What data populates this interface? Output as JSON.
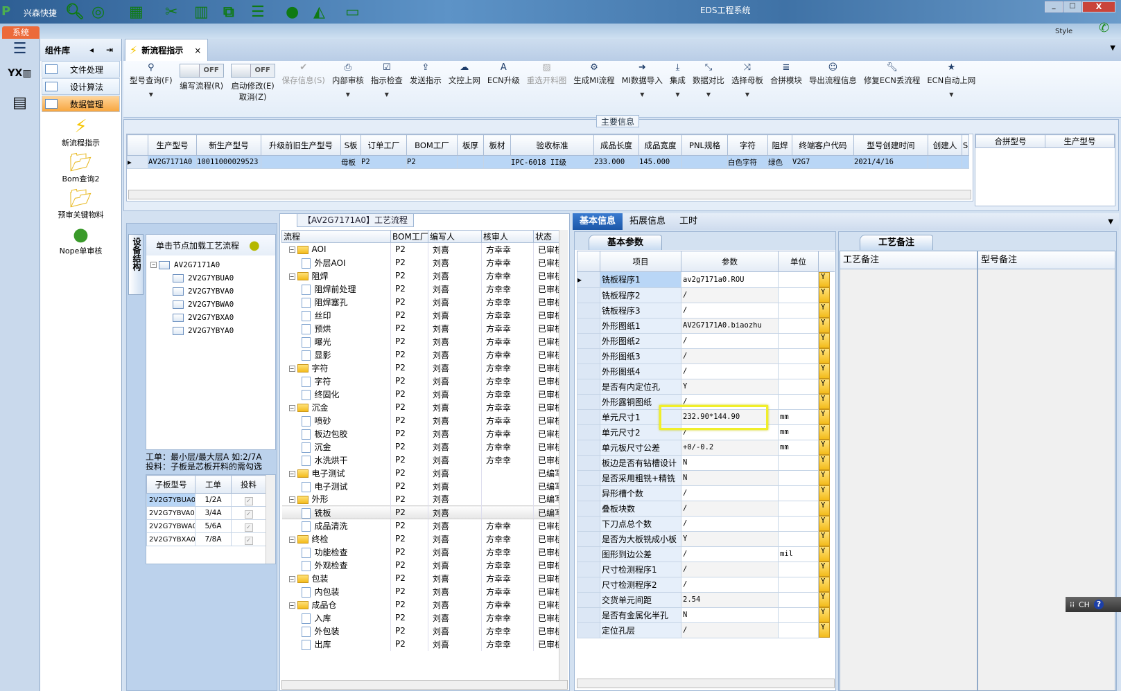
{
  "window": {
    "title": "EDS工程系统",
    "quick_label": "兴森快捷",
    "style_label": "Style",
    "menu_tab": "系统"
  },
  "colors": {
    "accent": "#1c57a8",
    "selected_row": "#b9d6f6",
    "highlight_box": "#f0ee2a",
    "system_tab": "#ec6a3a"
  },
  "component_panel": {
    "title": "组件库",
    "items": [
      {
        "label": "文件处理"
      },
      {
        "label": "设计算法"
      },
      {
        "label": "数据管理",
        "selected": true
      }
    ],
    "shortcuts": [
      {
        "label": "新流程指示",
        "icon": "lightning-icon"
      },
      {
        "label": "Bom查询2",
        "icon": "folder-open-icon"
      },
      {
        "label": "预审关键物料",
        "icon": "folder-open-icon"
      },
      {
        "label": "Nope单审核",
        "icon": "user-icon"
      }
    ]
  },
  "doc_tab": {
    "label": "新流程指示"
  },
  "toolbar": [
    {
      "label": "型号查询(F)",
      "icon": "search-icon",
      "dropdown": true
    },
    {
      "label": "编写流程(R)",
      "toggle": "OFF"
    },
    {
      "label": "启动修改(E)",
      "label2": "取消(Z)",
      "toggle": "OFF"
    },
    {
      "label": "保存信息(S)",
      "icon": "check-icon",
      "disabled": true
    },
    {
      "label": "内部审核",
      "icon": "print-icon",
      "dropdown": true
    },
    {
      "label": "指示检查",
      "icon": "checkbox-icon",
      "dropdown": true
    },
    {
      "label": "发送指示",
      "icon": "upload-icon"
    },
    {
      "label": "文控上网",
      "icon": "cloud-upload-icon"
    },
    {
      "label": "ECN升级",
      "icon": "font-icon"
    },
    {
      "label": "重选开料图",
      "icon": "image-icon",
      "disabled": true
    },
    {
      "label": "生成MI流程",
      "icon": "gears-icon"
    },
    {
      "label": "MI数据导入",
      "icon": "sign-in-icon",
      "dropdown": true
    },
    {
      "label": "集成",
      "icon": "download-icon",
      "dropdown": true
    },
    {
      "label": "数据对比",
      "icon": "compress-icon",
      "dropdown": true
    },
    {
      "label": "选择母板",
      "icon": "shuffle-icon",
      "dropdown": true
    },
    {
      "label": "合拼模块",
      "icon": "list-icon"
    },
    {
      "label": "导出流程信息",
      "icon": "smile-icon"
    },
    {
      "label": "修复ECN丢流程",
      "icon": "wrench-icon"
    },
    {
      "label": "ECN自动上网",
      "icon": "star-icon",
      "dropdown": true
    }
  ],
  "main_info": {
    "title": "主要信息",
    "columns": [
      "生产型号",
      "新生产型号",
      "升级前旧生产型号",
      "S板",
      "订单工厂",
      "BOM工厂",
      "板厚",
      "板材",
      "验收标准",
      "成品长度",
      "成品宽度",
      "PNL规格",
      "字符",
      "阻焊",
      "终端客户代码",
      "型号创建时间",
      "创建人",
      "S"
    ],
    "rows": [
      [
        "AV2G7171A0",
        "10011000029523",
        "",
        "母板",
        "P2",
        "P2",
        "",
        "",
        "IPC-6018 II级",
        "233.000",
        "145.000",
        "",
        "白色字符",
        "绿色",
        "V2G7",
        "2021/4/16",
        "",
        ""
      ]
    ],
    "merge_columns": [
      "合拼型号",
      "生产型号"
    ]
  },
  "left_panel": {
    "vertical_tab": "设备结构",
    "tree_header": "单击节点加载工艺流程",
    "tree": {
      "root": "AV2G7171A0",
      "children": [
        "2V2G7YBUA0",
        "2V2G7YBVA0",
        "2V2G7YBWA0",
        "2V2G7YBXA0",
        "2V2G7YBYA0"
      ]
    },
    "note1": "工单：最小层/最大层A 如:2/7A",
    "note2": "投料：子板是芯板开料的需勾选",
    "child_table": {
      "columns": [
        "子板型号",
        "工单",
        "投料"
      ],
      "rows": [
        [
          "2V2G7YBUA0",
          "1/2A",
          true
        ],
        [
          "2V2G7YBVA0",
          "3/4A",
          true
        ],
        [
          "2V2G7YBWA0",
          "5/6A",
          true
        ],
        [
          "2V2G7YBXA0",
          "7/8A",
          true
        ]
      ]
    }
  },
  "process": {
    "title": "【AV2G7171A0】工艺流程",
    "columns": [
      "流程",
      "BOM工厂",
      "编写人",
      "核审人",
      "状态"
    ],
    "rows": [
      {
        "name": "AOI",
        "folder": true,
        "bom": "P2",
        "writer": "刘喜",
        "reviewer": "方幸幸",
        "status": "已审核"
      },
      {
        "name": "外层AOI",
        "bom": "P2",
        "writer": "刘喜",
        "reviewer": "方幸幸",
        "status": "已审核"
      },
      {
        "name": "阻焊",
        "folder": true,
        "bom": "P2",
        "writer": "刘喜",
        "reviewer": "方幸幸",
        "status": "已审核"
      },
      {
        "name": "阻焊前处理",
        "bom": "P2",
        "writer": "刘喜",
        "reviewer": "方幸幸",
        "status": "已审核"
      },
      {
        "name": "阻焊塞孔",
        "bom": "P2",
        "writer": "刘喜",
        "reviewer": "方幸幸",
        "status": "已审核"
      },
      {
        "name": "丝印",
        "bom": "P2",
        "writer": "刘喜",
        "reviewer": "方幸幸",
        "status": "已审核"
      },
      {
        "name": "预烘",
        "bom": "P2",
        "writer": "刘喜",
        "reviewer": "方幸幸",
        "status": "已审核"
      },
      {
        "name": "曝光",
        "bom": "P2",
        "writer": "刘喜",
        "reviewer": "方幸幸",
        "status": "已审核"
      },
      {
        "name": "显影",
        "bom": "P2",
        "writer": "刘喜",
        "reviewer": "方幸幸",
        "status": "已审核"
      },
      {
        "name": "字符",
        "folder": true,
        "bom": "P2",
        "writer": "刘喜",
        "reviewer": "方幸幸",
        "status": "已审核"
      },
      {
        "name": "字符",
        "bom": "P2",
        "writer": "刘喜",
        "reviewer": "方幸幸",
        "status": "已审核"
      },
      {
        "name": "终固化",
        "bom": "P2",
        "writer": "刘喜",
        "reviewer": "方幸幸",
        "status": "已审核"
      },
      {
        "name": "沉金",
        "folder": true,
        "bom": "P2",
        "writer": "刘喜",
        "reviewer": "方幸幸",
        "status": "已审核"
      },
      {
        "name": "喷砂",
        "bom": "P2",
        "writer": "刘喜",
        "reviewer": "方幸幸",
        "status": "已审核"
      },
      {
        "name": "板边包胶",
        "bom": "P2",
        "writer": "刘喜",
        "reviewer": "方幸幸",
        "status": "已审核"
      },
      {
        "name": "沉金",
        "bom": "P2",
        "writer": "刘喜",
        "reviewer": "方幸幸",
        "status": "已审核"
      },
      {
        "name": "水洗烘干",
        "bom": "P2",
        "writer": "刘喜",
        "reviewer": "方幸幸",
        "status": "已审核"
      },
      {
        "name": "电子测试",
        "folder": true,
        "bom": "P2",
        "writer": "刘喜",
        "reviewer": "",
        "status": "已编写"
      },
      {
        "name": "电子测试",
        "bom": "P2",
        "writer": "刘喜",
        "reviewer": "",
        "status": "已编写"
      },
      {
        "name": "外形",
        "folder": true,
        "bom": "P2",
        "writer": "刘喜",
        "reviewer": "",
        "status": "已编写"
      },
      {
        "name": "铣板",
        "bom": "P2",
        "writer": "刘喜",
        "reviewer": "",
        "status": "已编写",
        "selected": true
      },
      {
        "name": "成品清洗",
        "bom": "P2",
        "writer": "刘喜",
        "reviewer": "方幸幸",
        "status": "已审核"
      },
      {
        "name": "终检",
        "folder": true,
        "bom": "P2",
        "writer": "刘喜",
        "reviewer": "方幸幸",
        "status": "已审核"
      },
      {
        "name": "功能检查",
        "bom": "P2",
        "writer": "刘喜",
        "reviewer": "方幸幸",
        "status": "已审核"
      },
      {
        "name": "外观检查",
        "bom": "P2",
        "writer": "刘喜",
        "reviewer": "方幸幸",
        "status": "已审核"
      },
      {
        "name": "包装",
        "folder": true,
        "bom": "P2",
        "writer": "刘喜",
        "reviewer": "方幸幸",
        "status": "已审核"
      },
      {
        "name": "内包装",
        "bom": "P2",
        "writer": "刘喜",
        "reviewer": "方幸幸",
        "status": "已审核"
      },
      {
        "name": "成品仓",
        "folder": true,
        "bom": "P2",
        "writer": "刘喜",
        "reviewer": "方幸幸",
        "status": "已审核"
      },
      {
        "name": "入库",
        "bom": "P2",
        "writer": "刘喜",
        "reviewer": "方幸幸",
        "status": "已审核"
      },
      {
        "name": "外包装",
        "bom": "P2",
        "writer": "刘喜",
        "reviewer": "方幸幸",
        "status": "已审核"
      },
      {
        "name": "出库",
        "bom": "P2",
        "writer": "刘喜",
        "reviewer": "方幸幸",
        "status": "已审核"
      }
    ]
  },
  "info_tabs": [
    {
      "label": "基本信息",
      "selected": true
    },
    {
      "label": "拓展信息"
    },
    {
      "label": "工时"
    }
  ],
  "params": {
    "subtab": "基本参数",
    "columns": [
      "项目",
      "参数",
      "单位",
      ""
    ],
    "rows": [
      [
        "铣板程序1",
        "av2g7171a0.ROU",
        "",
        "Y"
      ],
      [
        "铣板程序2",
        "/",
        "",
        "Y"
      ],
      [
        "铣板程序3",
        "/",
        "",
        "Y"
      ],
      [
        "外形图纸1",
        "AV2G7171A0.biaozhu",
        "",
        "Y"
      ],
      [
        "外形图纸2",
        "/",
        "",
        "Y"
      ],
      [
        "外形图纸3",
        "/",
        "",
        "Y"
      ],
      [
        "外形图纸4",
        "/",
        "",
        "Y"
      ],
      [
        "是否有内定位孔",
        "Y",
        "",
        "Y"
      ],
      [
        "外形露铜图纸",
        "/",
        "",
        "Y"
      ],
      [
        "单元尺寸1",
        "232.90*144.90",
        "mm",
        "Y"
      ],
      [
        "单元尺寸2",
        "/",
        "mm",
        "Y"
      ],
      [
        "单元板尺寸公差",
        "+0/-0.2",
        "mm",
        "Y"
      ],
      [
        "板边是否有钻槽设计",
        "N",
        "",
        "Y"
      ],
      [
        "是否采用粗铣+精铣",
        "N",
        "",
        "Y"
      ],
      [
        "异形槽个数",
        "/",
        "",
        "Y"
      ],
      [
        "叠板块数",
        "/",
        "",
        "Y"
      ],
      [
        "下刀点总个数",
        "/",
        "",
        "Y"
      ],
      [
        "是否为大板铣成小板",
        "Y",
        "",
        "Y"
      ],
      [
        "图形到边公差",
        "/",
        "mil",
        "Y"
      ],
      [
        "尺寸检测程序1",
        "/",
        "",
        "Y"
      ],
      [
        "尺寸检测程序2",
        "/",
        "",
        "Y"
      ],
      [
        "交货单元间距",
        "2.54",
        "",
        "Y"
      ],
      [
        "是否有金属化半孔",
        "N",
        "",
        "Y"
      ],
      [
        "定位孔层",
        "/",
        "",
        "Y"
      ]
    ]
  },
  "remarks": {
    "tab": "工艺备注",
    "columns": [
      "工艺备注",
      "型号备注"
    ]
  },
  "ime": {
    "label": "CH"
  }
}
